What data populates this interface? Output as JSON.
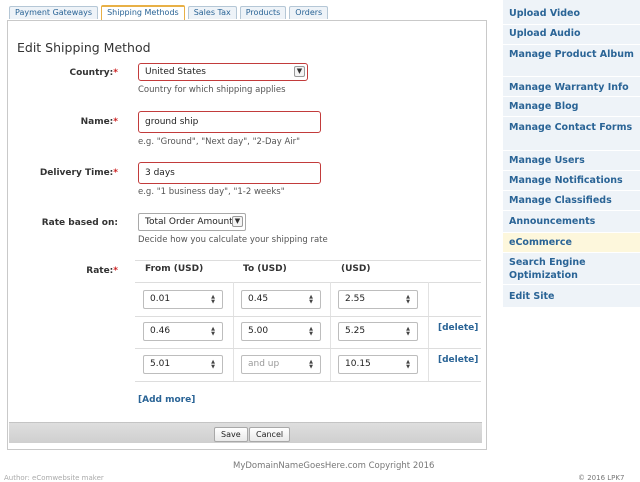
{
  "tabs": [
    "Payment Gateways",
    "Shipping Methods",
    "Sales Tax",
    "Products",
    "Orders"
  ],
  "active_tab": 1,
  "form": {
    "title": "Edit Shipping Method",
    "country": {
      "label": "Country:",
      "required": "*",
      "value": "United States",
      "hint": "Country for which shipping applies"
    },
    "name": {
      "label": "Name:",
      "required": "*",
      "value": "ground ship",
      "hint": "e.g. \"Ground\", \"Next day\", \"2-Day Air\""
    },
    "delivery": {
      "label": "Delivery Time:",
      "required": "*",
      "value": "3 days",
      "hint": "e.g. \"1 business day\", \"1-2 weeks\""
    },
    "rate_based": {
      "label": "Rate based on:",
      "value": "Total Order Amount",
      "hint": "Decide how you calculate your shipping rate"
    },
    "rate": {
      "label": "Rate:",
      "required": "*",
      "headers": [
        "From (USD)",
        "To (USD)",
        "(USD)"
      ],
      "rows": [
        {
          "from": "0.01",
          "to": "0.45",
          "amount": "2.55",
          "delete": ""
        },
        {
          "from": "0.46",
          "to": "5.00",
          "amount": "5.25",
          "delete": "[delete]"
        },
        {
          "from": "5.01",
          "to_placeholder": "and up",
          "amount": "10.15",
          "delete": "[delete]"
        }
      ],
      "add_more": "[Add more]"
    },
    "save_label": "Save",
    "cancel_label": "Cancel"
  },
  "sidebar": {
    "items": [
      {
        "label": "Upload Video"
      },
      {
        "label": "Upload Audio"
      },
      {
        "label": "Manage Product Album"
      },
      {
        "label": "Manage Warranty Info"
      },
      {
        "label": "Manage Blog"
      },
      {
        "label": "Manage Contact Forms"
      },
      {
        "label": "Manage Users"
      },
      {
        "label": "Manage Notifications"
      },
      {
        "label": "Manage Classifieds"
      },
      {
        "label": "Announcements"
      },
      {
        "label": "eCommerce"
      },
      {
        "label": "Search Engine Optimization"
      },
      {
        "label": "Edit Site"
      }
    ],
    "active_item": "eCommerce"
  },
  "footer": {
    "copyright": "MyDomainNameGoesHere.com Copyright 2016",
    "left_text": "Author: eComwebsite maker",
    "right_text": "© 2016 LPK7"
  },
  "colors": {
    "link": "#2a6496",
    "required": "#cc2222",
    "active_tab_border": "#e8b046",
    "sidebar_bg": "#eef3f8"
  },
  "icons": {
    "dropdown": "chevron-down-icon",
    "spinner": "up-down-arrows-icon"
  }
}
